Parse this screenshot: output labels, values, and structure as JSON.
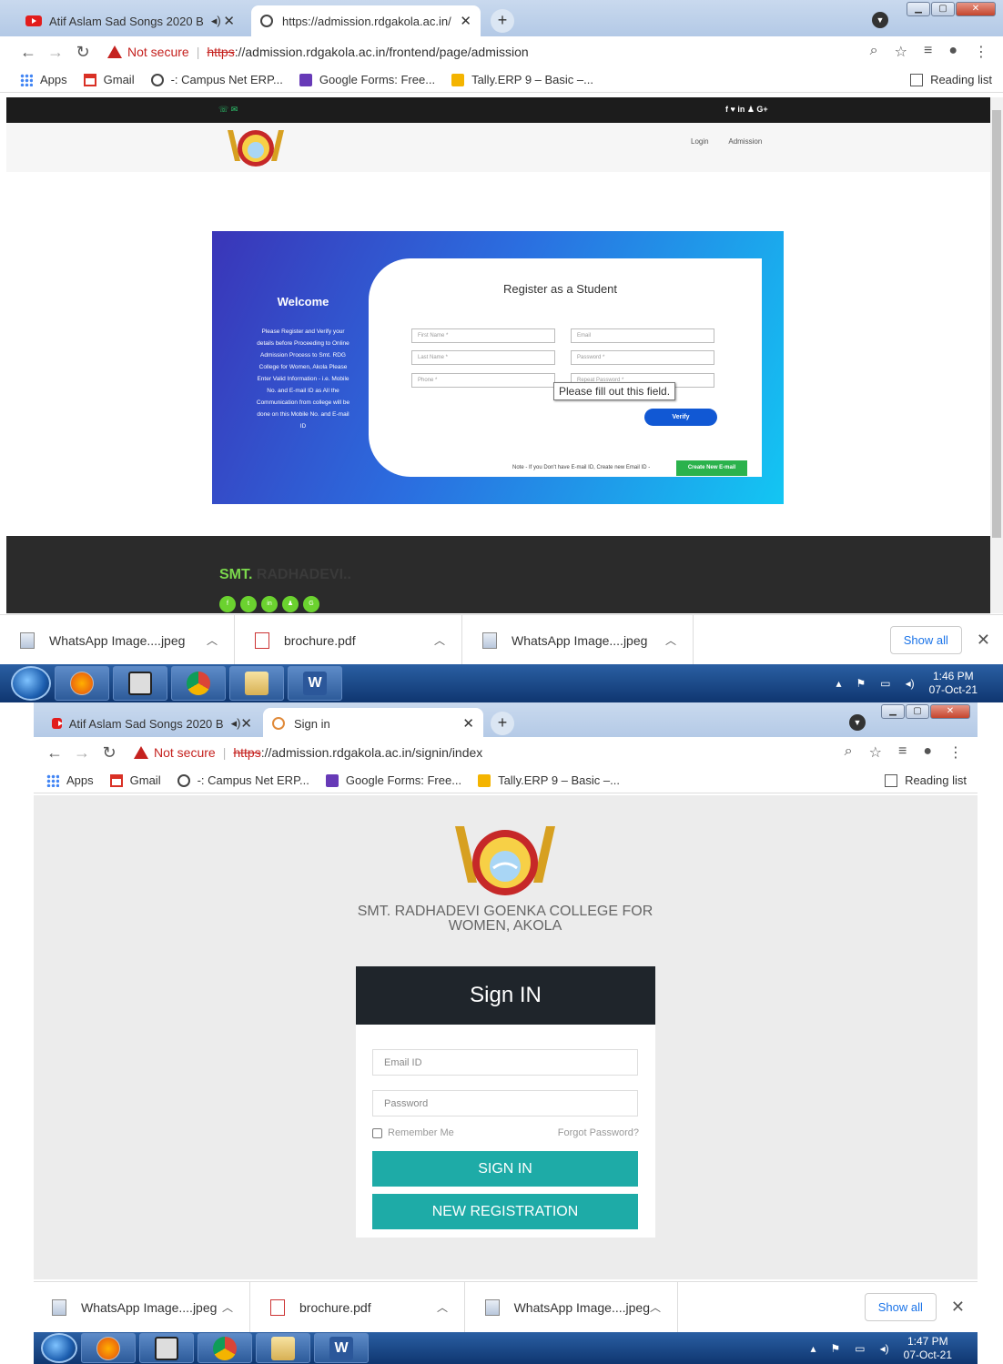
{
  "screens": [
    {
      "tabs": [
        {
          "title": "Atif Aslam Sad Songs 2020 B"
        },
        {
          "title": "https://admission.rdgakola.ac.in/"
        }
      ],
      "address": {
        "warning": "Not secure",
        "scheme": "https",
        "rest": "://admission.rdgakola.ac.in/frontend/page/admission"
      },
      "page": {
        "nav": {
          "login": "Login",
          "admission": "Admission"
        },
        "welcome_title": "Welcome",
        "welcome_text": "Please Register and Verify your details before Proceeding to Online Admission Process to Smt. RDG College for Women, Akola Please Enter Valid Information - i.e. Mobile No. and E-mail ID as All the Communication from college will be done on this Mobile No. and E-mail ID",
        "register_title": "Register as a Student",
        "fields": {
          "first_name": "First Name *",
          "last_name": "Last Name *",
          "phone": "Phone *",
          "email": "Email",
          "password": "Password *",
          "repeat_password": "Repeat Password *"
        },
        "tooltip": "Please fill out this field.",
        "verify": "Verify",
        "note": "Note - If you Don't have E-mail ID, Create new Email ID -",
        "create_email": "Create New E-mail",
        "footer_brand": "SMT.",
        "footer_brand_dim": "RADHADEVI.."
      },
      "clock": {
        "time": "1:46 PM",
        "date": "07-Oct-21"
      }
    },
    {
      "tabs": [
        {
          "title": "Atif Aslam Sad Songs 2020 B"
        },
        {
          "title": "Sign in"
        }
      ],
      "address": {
        "warning": "Not secure",
        "scheme": "https",
        "rest": "://admission.rdgakola.ac.in/signin/index"
      },
      "page": {
        "college_name": "SMT. RADHADEVI GOENKA COLLEGE FOR WOMEN, AKOLA",
        "signin_title": "Sign IN",
        "email_placeholder": "Email ID",
        "password_placeholder": "Password",
        "remember": "Remember Me",
        "forgot": "Forgot Password?",
        "signin_button": "SIGN IN",
        "register_button": "NEW REGISTRATION"
      },
      "clock": {
        "time": "1:47 PM",
        "date": "07-Oct-21"
      }
    }
  ],
  "bookmarks": [
    "Apps",
    "Gmail",
    "-: Campus Net ERP...",
    "Google Forms: Free...",
    "Tally.ERP 9 – Basic –..."
  ],
  "reading_list": "Reading list",
  "downloads": [
    "WhatsApp Image....jpeg",
    "brochure.pdf",
    "WhatsApp Image....jpeg"
  ],
  "show_all": "Show all"
}
